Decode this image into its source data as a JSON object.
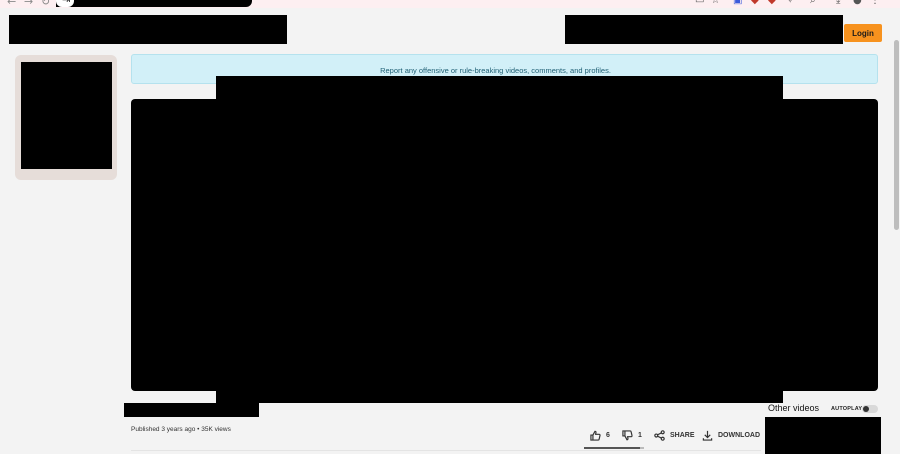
{
  "browser": {
    "back_glyph": "←",
    "forward_glyph": "→",
    "reload_glyph": "↻",
    "site_info_glyph": "⇥",
    "ext_icons": [
      "monitor-icon",
      "star-icon",
      "extension-icon",
      "extension-icon",
      "extension-icon",
      "puzzle-icon",
      "search-icon",
      "download-icon",
      "profile-icon",
      "menu-icon"
    ],
    "ext_glyphs": [
      "▭",
      "☆",
      "▣",
      "◆",
      "◆",
      "✧",
      "⌕",
      "⤓",
      "●",
      "⋮"
    ]
  },
  "header": {
    "login_label": "Login"
  },
  "notice": {
    "text": "Report any offensive or rule-breaking videos, comments, and profiles."
  },
  "video": {
    "meta": "Published 3 years ago • 35K views",
    "likes": "6",
    "dislikes": "1",
    "share_label": "SHARE",
    "download_label": "DOWNLOAD"
  },
  "sidebar": {
    "other_videos_label": "Other videos",
    "autoplay_label": "AUTOPLAY",
    "autoplay_on": false
  },
  "colors": {
    "accent": "#f7921e",
    "notice_bg": "#d2f0f8",
    "notice_text": "#1f5f74",
    "page_bg": "#f3f3f3"
  }
}
